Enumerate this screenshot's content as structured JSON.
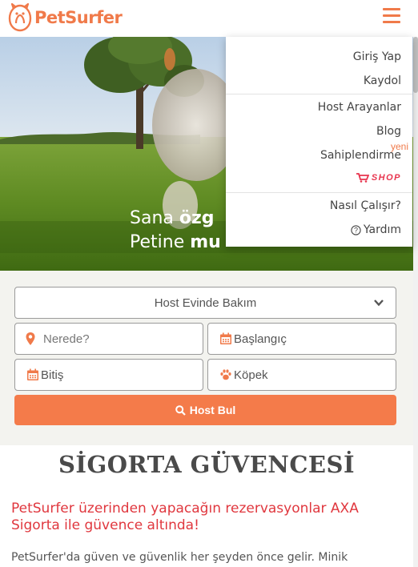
{
  "brand": {
    "name": "PetSurfer",
    "color": "#f07a4a"
  },
  "hero": {
    "line1_normal": "Sana ",
    "line1_bold": "özg",
    "line2_normal": "Petine ",
    "line2_bold": "mu"
  },
  "menu": {
    "login": "Giriş Yap",
    "signup": "Kaydol",
    "host_seekers": "Host Arayanlar",
    "blog": "Blog",
    "adoption": "Sahiplendirme",
    "new_badge": "yeni",
    "shop": "SHOP",
    "how_it_works": "Nasıl Çalışır?",
    "help": "Yardım"
  },
  "search": {
    "service_type": "Host Evinde Bakım",
    "location_placeholder": "Nerede?",
    "start_date": "Başlangıç",
    "end_date": "Bitiş",
    "pet_type": "Köpek",
    "submit": "Host Bul"
  },
  "insurance": {
    "title": "SİGORTA GÜVENCESİ",
    "subtitle": "PetSurfer üzerinden yapacağın rezervasyonlar AXA Sigorta ile güvence altında!",
    "body": "PetSurfer'da güven ve güvenlik her şeyden önce gelir. Minik"
  },
  "icons": [
    "hamburger-icon",
    "map-pin-icon",
    "calendar-icon",
    "paw-icon",
    "search-icon",
    "cart-icon",
    "help-icon",
    "chevron-down-icon"
  ]
}
